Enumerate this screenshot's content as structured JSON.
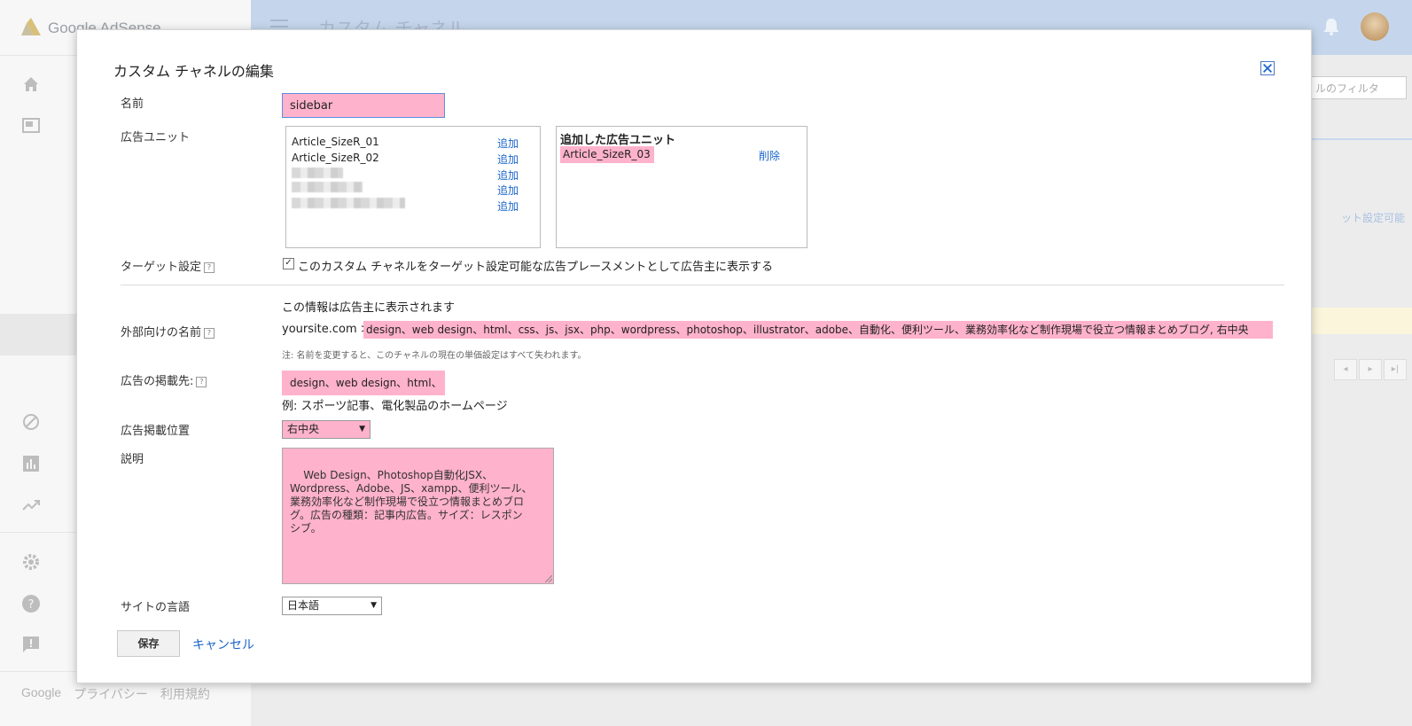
{
  "app": {
    "logo_text": "Google AdSense",
    "page_title": "カスタム チャネル",
    "filter_placeholder": "ルのフィルタ",
    "bg_link": "ット設定可能",
    "footer": {
      "google": "Google",
      "privacy": "プライバシー",
      "terms": "利用規約"
    }
  },
  "dialog": {
    "title": "カスタム チャネルの編集",
    "name": {
      "label": "名前",
      "value": "sidebar"
    },
    "ad_units": {
      "label": "広告ユニット",
      "available": [
        {
          "name": "Article_SizeR_01",
          "action": "追加"
        },
        {
          "name": "Article_SizeR_02",
          "action": "追加"
        },
        {
          "name": "",
          "action": "追加"
        },
        {
          "name": "",
          "action": "追加"
        },
        {
          "name": "",
          "action": "追加"
        }
      ],
      "added_header": "追加した広告ユニット",
      "added": [
        {
          "name": "Article_SizeR_03",
          "action": "削除"
        }
      ]
    },
    "targeting": {
      "label": "ターゲット設定",
      "checked": true,
      "checkbox_label": "このカスタム チャネルをターゲット設定可能な広告プレースメントとして広告主に表示する"
    },
    "info_note": "この情報は広告主に表示されます",
    "external_name": {
      "label": "外部向けの名前",
      "prefix": "yoursite.com >>",
      "value": "design、web design、html、css、js、jsx、php、wordpress、photoshop、illustrator、adobe、自動化、便利ツール、業務効率化など制作現場で役立つ情報まとめブログ, 右中央",
      "note": "注: 名前を変更すると、このチャネルの現在の単価設定はすべて失われます。"
    },
    "placement": {
      "label": "広告の掲載先:",
      "value": "design、web design、html、",
      "example": "例: スポーツ記事、電化製品のホームページ"
    },
    "position": {
      "label": "広告掲載位置",
      "value": "右中央"
    },
    "description": {
      "label": "説明",
      "value": "Web Design、Photoshop自動化JSX、\nWordpress、Adobe、JS、xampp、便利ツール、\n業務効率化など制作現場で役立つ情報まとめブロ\nグ。広告の種類：記事内広告。サイズ：レスポン\nシブ。"
    },
    "language": {
      "label": "サイトの言語",
      "value": "日本語"
    },
    "buttons": {
      "save": "保存",
      "cancel": "キャンセル"
    }
  },
  "colors": {
    "highlight": "#ffb2cb",
    "link": "#1a65c9",
    "topbar": "#c5d6ec"
  }
}
